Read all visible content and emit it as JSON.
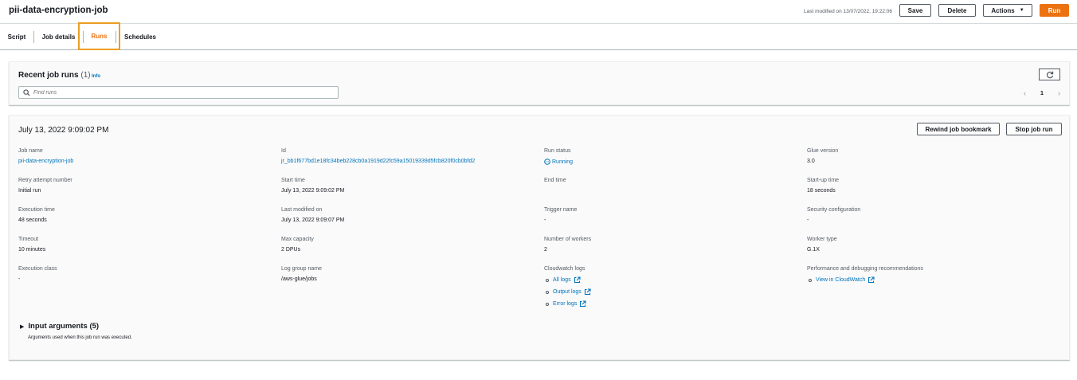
{
  "header": {
    "title": "pii-data-encryption-job",
    "last_modified": "Last modified on 13/07/2022, 19:22:06",
    "save_label": "Save",
    "delete_label": "Delete",
    "actions_label": "Actions",
    "run_label": "Run"
  },
  "tabs": [
    {
      "label": "Script"
    },
    {
      "label": "Job details"
    },
    {
      "label": "Runs",
      "active": true
    },
    {
      "label": "Schedules"
    }
  ],
  "runs_panel": {
    "title": "Recent job runs",
    "count": "(1)",
    "info": "Info",
    "search_placeholder": "Find runs",
    "page": "1"
  },
  "run_detail": {
    "date": "July 13, 2022 9:09:02 PM",
    "rewind_label": "Rewind job bookmark",
    "stop_label": "Stop job run",
    "fields": {
      "job_name": {
        "label": "Job name",
        "value": "pii-data-encryption-job"
      },
      "id": {
        "label": "Id",
        "value": "jr_bb1f677bd1e18fc34beb228cb0a1919d22fc59a15019339d5fcb820f0cb0bfd2"
      },
      "run_status": {
        "label": "Run status",
        "value": "Running"
      },
      "glue_version": {
        "label": "Glue version",
        "value": "3.0"
      },
      "retry": {
        "label": "Retry attempt number",
        "value": "Initial run"
      },
      "start_time": {
        "label": "Start time",
        "value": "July 13, 2022 9:09:02 PM"
      },
      "end_time": {
        "label": "End time",
        "value": ""
      },
      "startup_time": {
        "label": "Start-up time",
        "value": "18 seconds"
      },
      "execution_time": {
        "label": "Execution time",
        "value": "48 seconds"
      },
      "last_modified_on": {
        "label": "Last modified on",
        "value": "July 13, 2022 9:09:07 PM"
      },
      "trigger_name": {
        "label": "Trigger name",
        "value": "-"
      },
      "security_config": {
        "label": "Security configuration",
        "value": "-"
      },
      "timeout": {
        "label": "Timeout",
        "value": "10 minutes"
      },
      "max_capacity": {
        "label": "Max capacity",
        "value": "2 DPUs"
      },
      "num_workers": {
        "label": "Number of workers",
        "value": "2"
      },
      "worker_type": {
        "label": "Worker type",
        "value": "G.1X"
      },
      "execution_class": {
        "label": "Execution class",
        "value": "-"
      },
      "log_group": {
        "label": "Log group name",
        "value": "/aws-glue/jobs"
      },
      "cloudwatch_logs": {
        "label": "Cloudwatch logs",
        "links": [
          "All logs",
          "Output logs",
          "Error logs"
        ]
      },
      "perf": {
        "label": "Performance and debugging recommendations",
        "links": [
          "View in CloudWatch"
        ]
      }
    },
    "input_args": {
      "title": "Input arguments (5)",
      "description": "Arguments used when this job run was executed."
    }
  },
  "colors": {
    "accent": "#ec7211",
    "link": "#0073bb",
    "tab_focus": "#ec9e22"
  }
}
